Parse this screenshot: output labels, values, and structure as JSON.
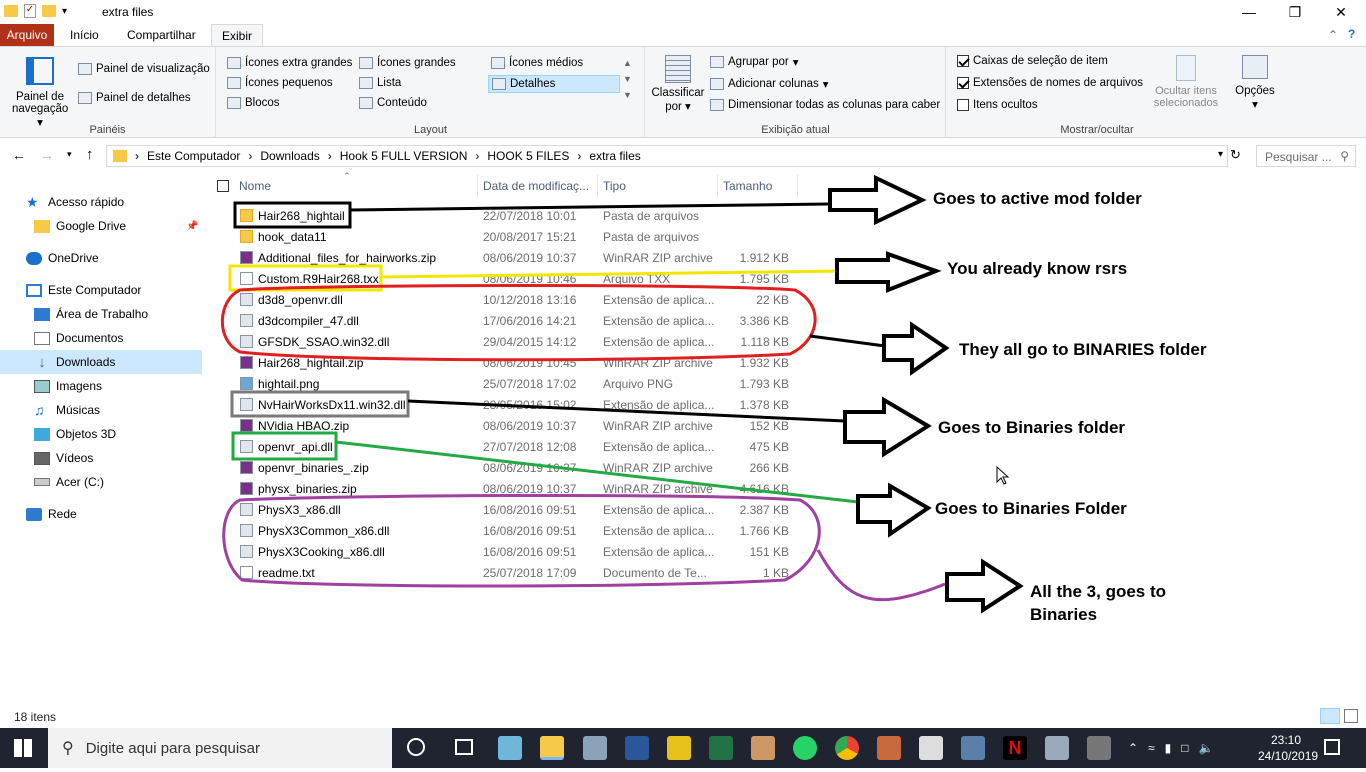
{
  "window": {
    "title": "extra files"
  },
  "ribbon_tabs": [
    "Arquivo",
    "Início",
    "Compartilhar",
    "Exibir"
  ],
  "ribbon": {
    "paineis": {
      "nav_pane": "Painel de navegação",
      "preview": "Painel de visualização",
      "details": "Painel de detalhes",
      "group": "Painéis"
    },
    "layout": {
      "items": [
        "Ícones extra grandes",
        "Ícones grandes",
        "Ícones médios",
        "Ícones pequenos",
        "Lista",
        "Detalhes",
        "Blocos",
        "Conteúdo"
      ],
      "group": "Layout"
    },
    "view": {
      "sort": "Classificar por",
      "group_by": "Agrupar por",
      "add_columns": "Adicionar colunas",
      "size_all": "Dimensionar todas as colunas para caber",
      "group": "Exibição atual"
    },
    "showhide": {
      "checkboxes": "Caixas de seleção de item",
      "extensions": "Extensões de nomes de arquivos",
      "hidden": "Itens ocultos",
      "hide_selected": "Ocultar itens selecionados",
      "options": "Opções",
      "group": "Mostrar/ocultar"
    }
  },
  "address": {
    "crumbs": [
      "Este Computador",
      "Downloads",
      "Hook 5 FULL VERSION",
      "HOOK 5 FILES",
      "extra files"
    ],
    "search_placeholder": "Pesquisar ..."
  },
  "nav": {
    "quick": "Acesso rápido",
    "gdrive": "Google Drive",
    "onedrive": "OneDrive",
    "pc": "Este Computador",
    "desktop": "Área de Trabalho",
    "docs": "Documentos",
    "downloads": "Downloads",
    "images": "Imagens",
    "music": "Músicas",
    "objects": "Objetos 3D",
    "videos": "Vídeos",
    "drive": "Acer (C:)",
    "network": "Rede"
  },
  "columns": {
    "name": "Nome",
    "date": "Data de modificaç...",
    "type": "Tipo",
    "size": "Tamanho"
  },
  "files": [
    {
      "name": "Hair268_hightail",
      "date": "22/07/2018 10:01",
      "type": "Pasta de arquivos",
      "size": "",
      "kind": "folder"
    },
    {
      "name": "hook_data11",
      "date": "20/08/2017 15:21",
      "type": "Pasta de arquivos",
      "size": "",
      "kind": "folder"
    },
    {
      "name": "Additional_files_for_hairworks.zip",
      "date": "08/06/2019 10:37",
      "type": "WinRAR ZIP archive",
      "size": "1.912 KB",
      "kind": "zip"
    },
    {
      "name": "Custom.R9Hair268.txx",
      "date": "08/06/2019 10:46",
      "type": "Arquivo TXX",
      "size": "1.795 KB",
      "kind": "file"
    },
    {
      "name": "d3d8_openvr.dll",
      "date": "10/12/2018 13:16",
      "type": "Extensão de aplica...",
      "size": "22 KB",
      "kind": "dll"
    },
    {
      "name": "d3dcompiler_47.dll",
      "date": "17/06/2016 14:21",
      "type": "Extensão de aplica...",
      "size": "3.386 KB",
      "kind": "dll"
    },
    {
      "name": "GFSDK_SSAO.win32.dll",
      "date": "29/04/2015 14:12",
      "type": "Extensão de aplica...",
      "size": "1.118 KB",
      "kind": "dll"
    },
    {
      "name": "Hair268_hightail.zip",
      "date": "08/06/2019 10:45",
      "type": "WinRAR ZIP archive",
      "size": "1.932 KB",
      "kind": "zip"
    },
    {
      "name": "hightail.png",
      "date": "25/07/2018 17:02",
      "type": "Arquivo PNG",
      "size": "1.793 KB",
      "kind": "png"
    },
    {
      "name": "NvHairWorksDx11.win32.dll",
      "date": "28/05/2016 15:02",
      "type": "Extensão de aplica...",
      "size": "1.378 KB",
      "kind": "dll"
    },
    {
      "name": "NVidia HBAO.zip",
      "date": "08/06/2019 10:37",
      "type": "WinRAR ZIP archive",
      "size": "152 KB",
      "kind": "zip"
    },
    {
      "name": "openvr_api.dll",
      "date": "27/07/2018 12:08",
      "type": "Extensão de aplica...",
      "size": "475 KB",
      "kind": "dll"
    },
    {
      "name": "openvr_binaries_.zip",
      "date": "08/06/2019 10:37",
      "type": "WinRAR ZIP archive",
      "size": "266 KB",
      "kind": "zip"
    },
    {
      "name": "physx_binaries.zip",
      "date": "08/06/2019 10:37",
      "type": "WinRAR ZIP archive",
      "size": "4.616 KB",
      "kind": "zip"
    },
    {
      "name": "PhysX3_x86.dll",
      "date": "16/08/2016 09:51",
      "type": "Extensão de aplica...",
      "size": "2.387 KB",
      "kind": "dll"
    },
    {
      "name": "PhysX3Common_x86.dll",
      "date": "16/08/2016 09:51",
      "type": "Extensão de aplica...",
      "size": "1.766 KB",
      "kind": "dll"
    },
    {
      "name": "PhysX3Cooking_x86.dll",
      "date": "16/08/2016 09:51",
      "type": "Extensão de aplica...",
      "size": "151 KB",
      "kind": "dll"
    },
    {
      "name": "readme.txt",
      "date": "25/07/2018 17:09",
      "type": "Documento de Te...",
      "size": "1 KB",
      "kind": "file"
    }
  ],
  "status": "18 itens",
  "notes": {
    "n1": "Goes to active mod folder",
    "n2": "You already know rsrs",
    "n3": "They all go to BINARIES folder",
    "n4": "Goes to Binaries folder",
    "n5": "Goes to Binaries Folder",
    "n6": "All the 3, goes to Binaries"
  },
  "taskbar": {
    "search": "Digite aqui para pesquisar",
    "time": "23:10",
    "date": "24/10/2019"
  },
  "colors": {
    "file_tab": "#b03018",
    "selected_nav": "#cce8ff",
    "taskbar": "#1f2430"
  }
}
